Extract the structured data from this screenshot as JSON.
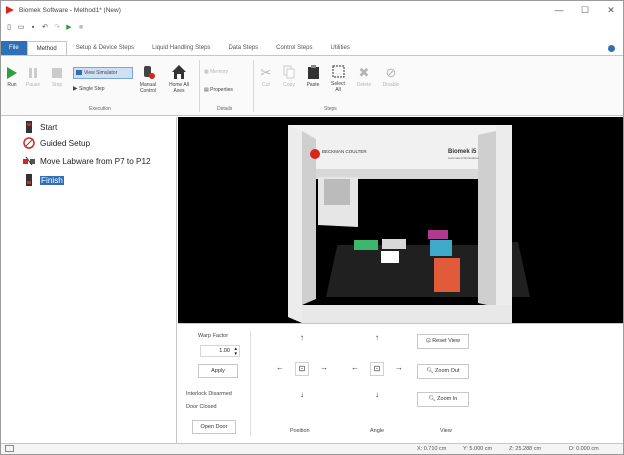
{
  "window": {
    "title": "Biomek Software - Method1* (New)",
    "controls": [
      "—",
      "☐",
      "✕"
    ]
  },
  "quick_access": [
    "new-icon",
    "open-icon",
    "save-icon",
    "undo-icon",
    "redo-icon",
    "run-icon",
    "stop-icon"
  ],
  "tabs": [
    {
      "label": "File"
    },
    {
      "label": "Method"
    },
    {
      "label": "Setup & Device Steps"
    },
    {
      "label": "Liquid Handling Steps"
    },
    {
      "label": "Data Steps"
    },
    {
      "label": "Control Steps"
    },
    {
      "label": "Utilities"
    }
  ],
  "ribbon": {
    "run": "Run",
    "pause": "Pause",
    "stop": "Stop",
    "view_simulator": "View Simulator",
    "single_step": "Single Step",
    "manual_control": "Manual Control",
    "home_all_axes": "Home All Axes",
    "memory": "Memory",
    "properties": "Properties",
    "cut": "Cut",
    "copy": "Copy",
    "paste": "Paste",
    "select_all": "Select All",
    "delete": "Delete",
    "disable": "Disable",
    "group_execution": "Execution",
    "group_details": "Details",
    "group_steps": "Steps"
  },
  "tree": [
    "Start",
    "Guided Setup",
    "Move Labware from P7 to P12",
    "Finish"
  ],
  "viewport": {
    "logo_left": "BECKMAN COULTER",
    "logo_right": "Biomek i5",
    "logo_right_sub": "Automated Workstation"
  },
  "controls": {
    "warp_factor_label": "Warp Factor",
    "warp_factor_value": "1.00",
    "apply": "Apply",
    "interlock": "Interlock Disarmed",
    "door": "Door Closed",
    "open_door": "Open Door",
    "position_label": "Position",
    "angle_label": "Angle",
    "view_label": "View",
    "reset_view": "Reset View",
    "zoom_out": "Zoom Out",
    "zoom_in": "Zoom In"
  },
  "status": {
    "x": "X: 0.710 cm",
    "y": "Y: 5.000 cm",
    "z": "Z: 25.288 cm",
    "d": "D: 0.000 cm"
  },
  "colors": {
    "accent": "#2f6fb5",
    "run_green": "#2e9e3e",
    "brand_red": "#d9261c"
  }
}
